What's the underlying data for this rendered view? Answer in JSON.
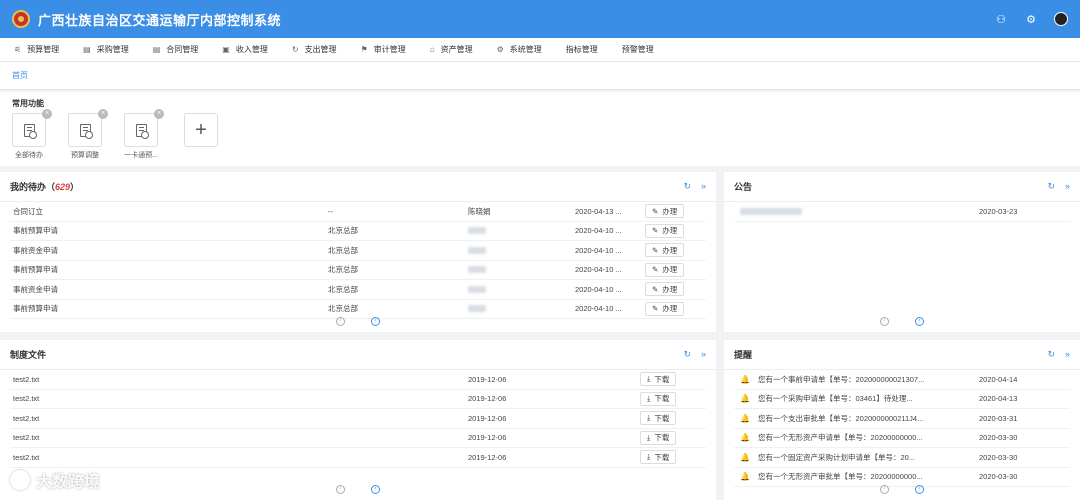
{
  "app": {
    "title": "广西壮族自治区交通运输厅内部控制系统"
  },
  "menu": [
    {
      "icon": "⚟",
      "label": "预算管理"
    },
    {
      "icon": "▤",
      "label": "采购管理"
    },
    {
      "icon": "▤",
      "label": "合同管理"
    },
    {
      "icon": "▣",
      "label": "收入管理"
    },
    {
      "icon": "↻",
      "label": "支出管理"
    },
    {
      "icon": "⚑",
      "label": "审计管理"
    },
    {
      "icon": "⌂",
      "label": "资产管理"
    },
    {
      "icon": "⚙",
      "label": "系统管理"
    },
    {
      "icon": "",
      "label": "指标管理"
    },
    {
      "icon": "",
      "label": "预警管理"
    }
  ],
  "tabs": {
    "home": "首页"
  },
  "quick": {
    "title": "常用功能",
    "items": [
      {
        "label": "全部待办"
      },
      {
        "label": "预算调整"
      },
      {
        "label": "一卡通预..."
      }
    ],
    "add": "+"
  },
  "todo": {
    "title": "我的待办（",
    "count": "629",
    "title_end": "）",
    "rows": [
      {
        "name": "合同订立",
        "dept": "--",
        "person": "陈晓娟",
        "date": "2020-04-13 ...",
        "action": "办理"
      },
      {
        "name": "事前预算申请",
        "dept": "北京总部",
        "date": "2020-04-10 ...",
        "action": "办理"
      },
      {
        "name": "事前资金申请",
        "dept": "北京总部",
        "date": "2020-04-10 ...",
        "action": "办理"
      },
      {
        "name": "事前预算申请",
        "dept": "北京总部",
        "date": "2020-04-10 ...",
        "action": "办理"
      },
      {
        "name": "事前资金申请",
        "dept": "北京总部",
        "date": "2020-04-10 ...",
        "action": "办理"
      },
      {
        "name": "事前预算申请",
        "dept": "北京总部",
        "date": "2020-04-10 ...",
        "action": "办理"
      }
    ]
  },
  "notice": {
    "title": "公告",
    "rows": [
      {
        "date": "2020-03-23"
      }
    ]
  },
  "files": {
    "title": "制度文件",
    "rows": [
      {
        "name": "test2.txt",
        "date": "2019-12-06",
        "action": "下载"
      },
      {
        "name": "test2.txt",
        "date": "2019-12-06",
        "action": "下载"
      },
      {
        "name": "test2.txt",
        "date": "2019-12-06",
        "action": "下载"
      },
      {
        "name": "test2.txt",
        "date": "2019-12-06",
        "action": "下载"
      },
      {
        "name": "test2.txt",
        "date": "2019-12-06",
        "action": "下载"
      }
    ]
  },
  "reminders": {
    "title": "提醒",
    "rows": [
      {
        "text": "您有一个事前申请单【单号：202000000021307...",
        "date": "2020-04-14"
      },
      {
        "text": "您有一个采购申请单【单号：03461】待处理...",
        "date": "2020-04-13"
      },
      {
        "text": "您有一个支出审批单【单号：2020000000211J4...",
        "date": "2020-03-31"
      },
      {
        "text": "您有一个无形资产申请单【单号：20200000000...",
        "date": "2020-03-30"
      },
      {
        "text": "您有一个固定资产采购计划申请单【单号：20...",
        "date": "2020-03-30"
      },
      {
        "text": "您有一个无形资产审批单【单号：20200000000...",
        "date": "2020-03-30"
      }
    ]
  },
  "watermark": {
    "text": "大数跨境"
  }
}
